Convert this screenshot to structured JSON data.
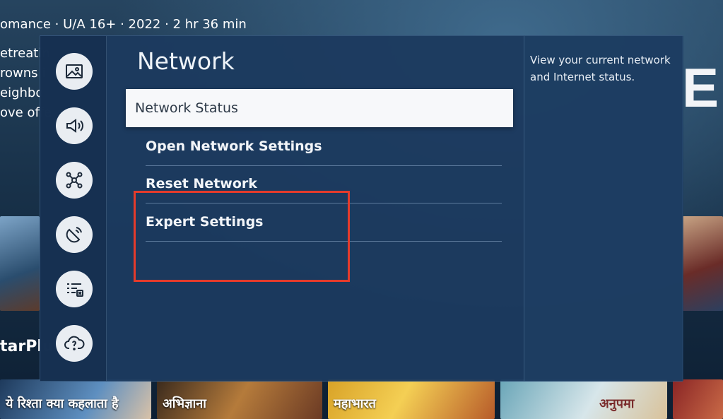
{
  "background": {
    "meta_line": "omance · U/A 16+ · 2022 · 2 hr 36 min",
    "description_lines": "etreatin\nrowns i\neighbo\nove offe",
    "channel_label": "tarPlu",
    "logo_fragment": "E",
    "thumbnails": [
      "ये रिश्ता क्या कहलाता है",
      "अभिज्ञाना",
      "महाभारत",
      "अनुपमा"
    ]
  },
  "sidebar": {
    "items": [
      {
        "icon": "picture-icon"
      },
      {
        "icon": "sound-icon"
      },
      {
        "icon": "network-icon"
      },
      {
        "icon": "broadcasting-icon"
      },
      {
        "icon": "general-icon"
      },
      {
        "icon": "support-icon"
      }
    ]
  },
  "settings": {
    "title": "Network",
    "items": [
      {
        "label": "Network Status",
        "selected": true
      },
      {
        "label": "Open Network Settings"
      },
      {
        "label": "Reset Network"
      },
      {
        "label": "Expert Settings"
      }
    ],
    "help_text": "View your current network and Internet status."
  },
  "colors": {
    "panel": "#1c3a5f",
    "highlight": "#e53b2b",
    "selected_bg": "#f7f8fa"
  }
}
